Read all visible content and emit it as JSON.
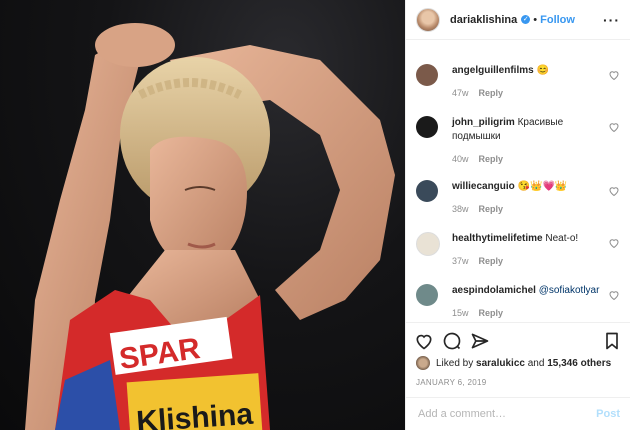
{
  "post": {
    "image_alt": "Athlete with blonde braided hair adjusting her hair, wearing red SPAR race top with Klishina bib",
    "image_text": {
      "sponsor": "SPAR",
      "bib_name": "Klishina"
    }
  },
  "header": {
    "username": "dariaklishina",
    "verified_glyph": "✓",
    "separator": "•",
    "follow_label": "Follow",
    "more_label": "···"
  },
  "comments": [
    {
      "username": "angelguillenfilms",
      "text": "😊",
      "age": "47w",
      "reply": "Reply",
      "avatar_color": "#7b5a4a"
    },
    {
      "username": "john_piligrim",
      "text": "Красивые подмышки",
      "age": "40w",
      "reply": "Reply",
      "avatar_color": "#1a1a1a"
    },
    {
      "username": "williecanguio",
      "text": "😘👑💗👑",
      "age": "38w",
      "reply": "Reply",
      "avatar_color": "#3a4a5a"
    },
    {
      "username": "healthytimelifetime",
      "text": "Neat-o!",
      "age": "37w",
      "reply": "Reply",
      "avatar_color": "#e9e2d5"
    },
    {
      "username": "aespindolamichel",
      "mention": "@sofiakotlyar",
      "age": "15w",
      "reply": "Reply",
      "avatar_color": "#6f8a8a"
    }
  ],
  "likes": {
    "prefix": "Liked by",
    "user": "saralukicc",
    "joiner": "and",
    "others": "15,346 others"
  },
  "date": "JANUARY 6, 2019",
  "add_comment": {
    "placeholder": "Add a comment…",
    "post_label": "Post"
  },
  "colors": {
    "accent": "#3897f0",
    "post_disabled": "#b2dffc",
    "meta": "#8e8e8e"
  }
}
